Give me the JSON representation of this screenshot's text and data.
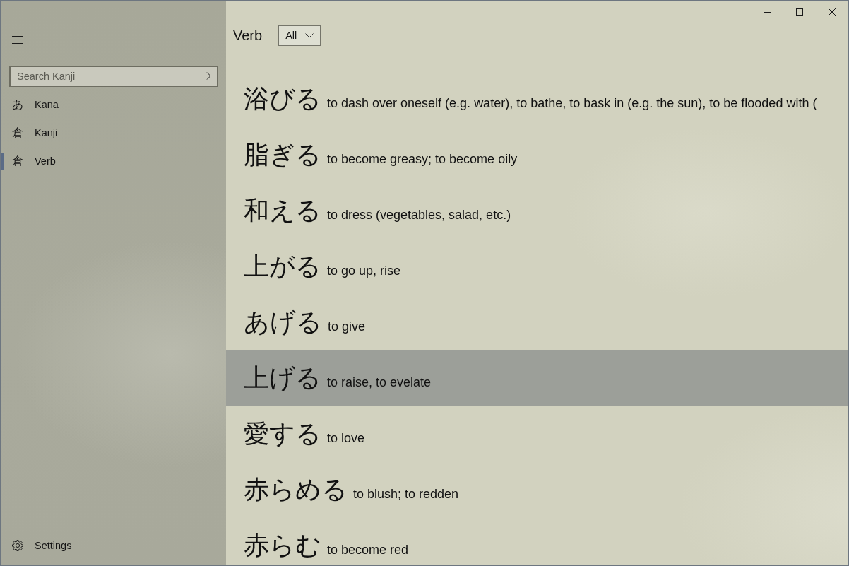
{
  "sidebar": {
    "search": {
      "placeholder": "Search Kanji"
    },
    "items": [
      {
        "glyph": "あ",
        "label": "Kana",
        "selected": false
      },
      {
        "glyph": "倉",
        "label": "Kanji",
        "selected": false
      },
      {
        "glyph": "倉",
        "label": "Verb",
        "selected": true
      }
    ],
    "footer": {
      "label": "Settings"
    }
  },
  "header": {
    "title": "Verb",
    "filter": "All"
  },
  "entries": [
    {
      "word": "浴びる",
      "meaning": "to dash over oneself (e.g. water), to bathe, to bask in (e.g. the sun), to be flooded with (",
      "selected": false
    },
    {
      "word": "脂ぎる",
      "meaning": "to become greasy; to become oily",
      "selected": false
    },
    {
      "word": "和える",
      "meaning": "to dress (vegetables, salad, etc.)",
      "selected": false
    },
    {
      "word": "上がる",
      "meaning": "to go up, rise",
      "selected": false
    },
    {
      "word": "あげる",
      "meaning": "to give",
      "selected": false
    },
    {
      "word": "上げる",
      "meaning": "to raise, to evelate",
      "selected": true
    },
    {
      "word": "愛する",
      "meaning": "to love",
      "selected": false
    },
    {
      "word": "赤らめる",
      "meaning": "to blush; to redden",
      "selected": false
    },
    {
      "word": "赤らむ",
      "meaning": "to become red",
      "selected": false
    }
  ]
}
